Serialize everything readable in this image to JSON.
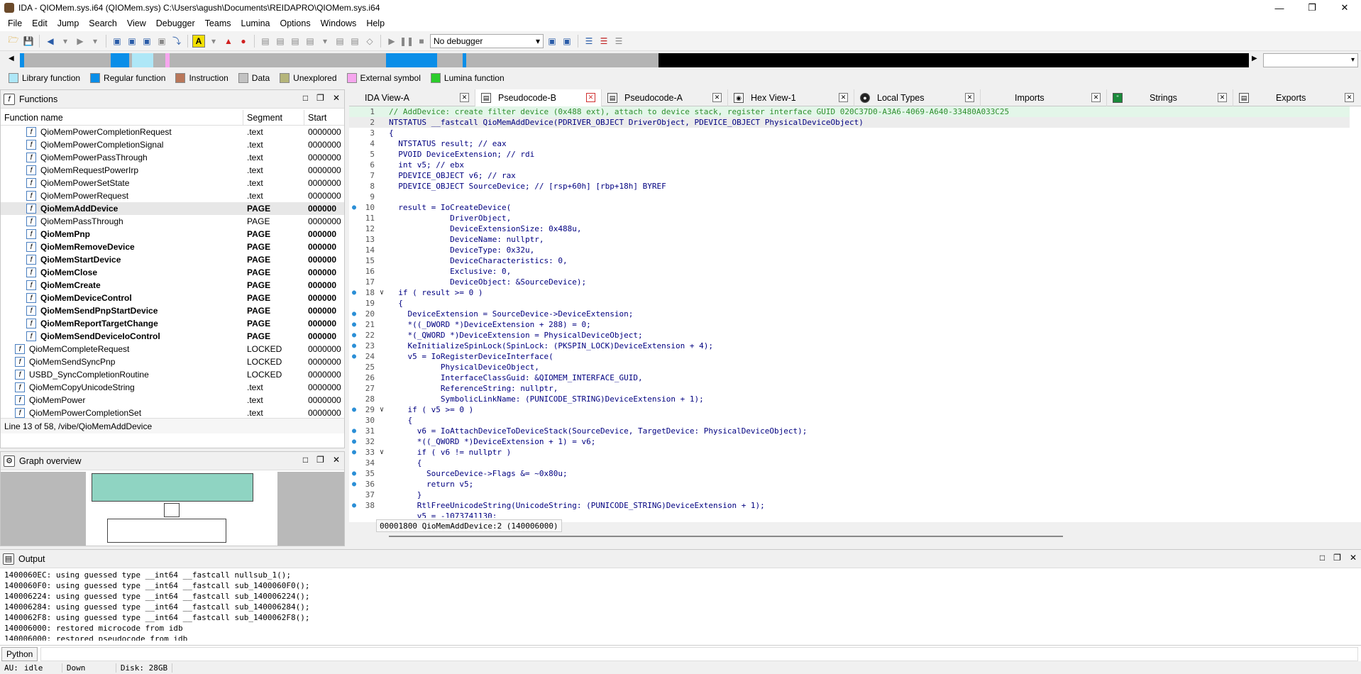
{
  "window": {
    "title": "IDA - QIOMem.sys.i64 (QIOMem.sys) C:\\Users\\agush\\Documents\\REIDAPRO\\QIOMem.sys.i64"
  },
  "menu": [
    "File",
    "Edit",
    "Jump",
    "Search",
    "View",
    "Debugger",
    "Teams",
    "Lumina",
    "Options",
    "Windows",
    "Help"
  ],
  "toolbar": {
    "debugger_select": "No debugger"
  },
  "legend": [
    {
      "label": "Library function",
      "color": "#aee7f7"
    },
    {
      "label": "Regular function",
      "color": "#0a8ee8"
    },
    {
      "label": "Instruction",
      "color": "#b9775a"
    },
    {
      "label": "Data",
      "color": "#c2c2c2"
    },
    {
      "label": "Unexplored",
      "color": "#b5b57a"
    },
    {
      "label": "External symbol",
      "color": "#f6a6ee"
    },
    {
      "label": "Lumina function",
      "color": "#2ccc2c"
    }
  ],
  "functions": {
    "title": "Functions",
    "columns": [
      "Function name",
      "Segment",
      "Start"
    ],
    "rows": [
      {
        "name": "QioMemPowerCompletionRequest",
        "segment": ".text",
        "start": "0000000",
        "bold": false,
        "indent": true
      },
      {
        "name": "QioMemPowerCompletionSignal",
        "segment": ".text",
        "start": "0000000",
        "bold": false,
        "indent": true
      },
      {
        "name": "QioMemPowerPassThrough",
        "segment": ".text",
        "start": "0000000",
        "bold": false,
        "indent": true
      },
      {
        "name": "QioMemRequestPowerIrp",
        "segment": ".text",
        "start": "0000000",
        "bold": false,
        "indent": true
      },
      {
        "name": "QioMemPowerSetState",
        "segment": ".text",
        "start": "0000000",
        "bold": false,
        "indent": true
      },
      {
        "name": "QioMemPowerRequest",
        "segment": ".text",
        "start": "0000000",
        "bold": false,
        "indent": true
      },
      {
        "name": "QioMemAddDevice",
        "segment": "PAGE",
        "start": "000000",
        "bold": true,
        "indent": true,
        "selected": true
      },
      {
        "name": "QioMemPassThrough",
        "segment": "PAGE",
        "start": "0000000",
        "bold": false,
        "indent": true
      },
      {
        "name": "QioMemPnp",
        "segment": "PAGE",
        "start": "000000",
        "bold": true,
        "indent": true
      },
      {
        "name": "QioMemRemoveDevice",
        "segment": "PAGE",
        "start": "000000",
        "bold": true,
        "indent": true
      },
      {
        "name": "QioMemStartDevice",
        "segment": "PAGE",
        "start": "000000",
        "bold": true,
        "indent": true
      },
      {
        "name": "QioMemClose",
        "segment": "PAGE",
        "start": "000000",
        "bold": true,
        "indent": true
      },
      {
        "name": "QioMemCreate",
        "segment": "PAGE",
        "start": "000000",
        "bold": true,
        "indent": true
      },
      {
        "name": "QioMemDeviceControl",
        "segment": "PAGE",
        "start": "000000",
        "bold": true,
        "indent": true
      },
      {
        "name": "QioMemSendPnpStartDevice",
        "segment": "PAGE",
        "start": "000000",
        "bold": true,
        "indent": true
      },
      {
        "name": "QioMemReportTargetChange",
        "segment": "PAGE",
        "start": "000000",
        "bold": true,
        "indent": true
      },
      {
        "name": "QioMemSendDeviceIoControl",
        "segment": "PAGE",
        "start": "000000",
        "bold": true,
        "indent": true
      },
      {
        "name": "QioMemCompleteRequest",
        "segment": "LOCKED",
        "start": "0000000",
        "bold": false,
        "indent": false
      },
      {
        "name": "QioMemSendSyncPnp",
        "segment": "LOCKED",
        "start": "0000000",
        "bold": false,
        "indent": false
      },
      {
        "name": "USBD_SyncCompletionRoutine",
        "segment": "LOCKED",
        "start": "0000000",
        "bold": false,
        "indent": false
      },
      {
        "name": "QioMemCopyUnicodeString",
        "segment": ".text",
        "start": "0000000",
        "bold": false,
        "indent": false
      },
      {
        "name": "QioMemPower",
        "segment": ".text",
        "start": "0000000",
        "bold": false,
        "indent": false
      },
      {
        "name": "QioMemPowerCompletionSet",
        "segment": ".text",
        "start": "0000000",
        "bold": false,
        "indent": false
      }
    ],
    "status": "Line 13 of 58, /vibe/QioMemAddDevice"
  },
  "graph_overview": {
    "title": "Graph overview"
  },
  "tabs": [
    {
      "label": "IDA View-A",
      "active": false
    },
    {
      "label": "Pseudocode-B",
      "active": true
    },
    {
      "label": "Pseudocode-A",
      "active": false
    },
    {
      "label": "Hex View-1",
      "active": false
    },
    {
      "label": "Local Types",
      "active": false
    },
    {
      "label": "Imports",
      "active": false
    },
    {
      "label": "Strings",
      "active": false
    },
    {
      "label": "Exports",
      "active": false
    }
  ],
  "code": {
    "lines": [
      {
        "n": "1",
        "t": "// AddDevice: create filter device (0x488 ext), attach to device stack, register interface GUID 020C37D0-A3A6-4069-A640-33480A033C25",
        "dot": false,
        "fold": "",
        "cls": "cmt hl"
      },
      {
        "n": "2",
        "t": "NTSTATUS __fastcall QioMemAddDevice(PDRIVER_OBJECT DriverObject, PDEVICE_OBJECT PhysicalDeviceObject)",
        "dot": false,
        "fold": "",
        "cls": "cur"
      },
      {
        "n": "3",
        "t": "{",
        "dot": false,
        "fold": "",
        "cls": ""
      },
      {
        "n": "4",
        "t": "  NTSTATUS result; // eax",
        "dot": false,
        "fold": "",
        "cls": ""
      },
      {
        "n": "5",
        "t": "  PVOID DeviceExtension; // rdi",
        "dot": false,
        "fold": "",
        "cls": ""
      },
      {
        "n": "6",
        "t": "  int v5; // ebx",
        "dot": false,
        "fold": "",
        "cls": ""
      },
      {
        "n": "7",
        "t": "  PDEVICE_OBJECT v6; // rax",
        "dot": false,
        "fold": "",
        "cls": ""
      },
      {
        "n": "8",
        "t": "  PDEVICE_OBJECT SourceDevice; // [rsp+60h] [rbp+18h] BYREF",
        "dot": false,
        "fold": "",
        "cls": ""
      },
      {
        "n": "9",
        "t": "",
        "dot": false,
        "fold": "",
        "cls": ""
      },
      {
        "n": "10",
        "t": "  result = IoCreateDevice(",
        "dot": true,
        "fold": "",
        "cls": ""
      },
      {
        "n": "11",
        "t": "             DriverObject,",
        "dot": false,
        "fold": "",
        "cls": ""
      },
      {
        "n": "12",
        "t": "             DeviceExtensionSize: 0x488u,",
        "dot": false,
        "fold": "",
        "cls": ""
      },
      {
        "n": "13",
        "t": "             DeviceName: nullptr,",
        "dot": false,
        "fold": "",
        "cls": ""
      },
      {
        "n": "14",
        "t": "             DeviceType: 0x32u,",
        "dot": false,
        "fold": "",
        "cls": ""
      },
      {
        "n": "15",
        "t": "             DeviceCharacteristics: 0,",
        "dot": false,
        "fold": "",
        "cls": ""
      },
      {
        "n": "16",
        "t": "             Exclusive: 0,",
        "dot": false,
        "fold": "",
        "cls": ""
      },
      {
        "n": "17",
        "t": "             DeviceObject: &SourceDevice);",
        "dot": false,
        "fold": "",
        "cls": ""
      },
      {
        "n": "18",
        "t": "  if ( result >= 0 )",
        "dot": true,
        "fold": "v",
        "cls": ""
      },
      {
        "n": "19",
        "t": "  {",
        "dot": false,
        "fold": "",
        "cls": ""
      },
      {
        "n": "20",
        "t": "    DeviceExtension = SourceDevice->DeviceExtension;",
        "dot": true,
        "fold": "",
        "cls": ""
      },
      {
        "n": "21",
        "t": "    *((_DWORD *)DeviceExtension + 288) = 0;",
        "dot": true,
        "fold": "",
        "cls": ""
      },
      {
        "n": "22",
        "t": "    *(_QWORD *)DeviceExtension = PhysicalDeviceObject;",
        "dot": true,
        "fold": "",
        "cls": ""
      },
      {
        "n": "23",
        "t": "    KeInitializeSpinLock(SpinLock: (PKSPIN_LOCK)DeviceExtension + 4);",
        "dot": true,
        "fold": "",
        "cls": ""
      },
      {
        "n": "24",
        "t": "    v5 = IoRegisterDeviceInterface(",
        "dot": true,
        "fold": "",
        "cls": ""
      },
      {
        "n": "25",
        "t": "           PhysicalDeviceObject,",
        "dot": false,
        "fold": "",
        "cls": ""
      },
      {
        "n": "26",
        "t": "           InterfaceClassGuid: &QIOMEM_INTERFACE_GUID,",
        "dot": false,
        "fold": "",
        "cls": ""
      },
      {
        "n": "27",
        "t": "           ReferenceString: nullptr,",
        "dot": false,
        "fold": "",
        "cls": ""
      },
      {
        "n": "28",
        "t": "           SymbolicLinkName: (PUNICODE_STRING)DeviceExtension + 1);",
        "dot": false,
        "fold": "",
        "cls": ""
      },
      {
        "n": "29",
        "t": "    if ( v5 >= 0 )",
        "dot": true,
        "fold": "v",
        "cls": ""
      },
      {
        "n": "30",
        "t": "    {",
        "dot": false,
        "fold": "",
        "cls": ""
      },
      {
        "n": "31",
        "t": "      v6 = IoAttachDeviceToDeviceStack(SourceDevice, TargetDevice: PhysicalDeviceObject);",
        "dot": true,
        "fold": "",
        "cls": ""
      },
      {
        "n": "32",
        "t": "      *((_QWORD *)DeviceExtension + 1) = v6;",
        "dot": true,
        "fold": "",
        "cls": ""
      },
      {
        "n": "33",
        "t": "      if ( v6 != nullptr )",
        "dot": true,
        "fold": "v",
        "cls": ""
      },
      {
        "n": "34",
        "t": "      {",
        "dot": false,
        "fold": "",
        "cls": ""
      },
      {
        "n": "35",
        "t": "        SourceDevice->Flags &= ~0x80u;",
        "dot": true,
        "fold": "",
        "cls": ""
      },
      {
        "n": "36",
        "t": "        return v5;",
        "dot": true,
        "fold": "",
        "cls": ""
      },
      {
        "n": "37",
        "t": "      }",
        "dot": false,
        "fold": "",
        "cls": ""
      },
      {
        "n": "38",
        "t": "      RtlFreeUnicodeString(UnicodeString: (PUNICODE_STRING)DeviceExtension + 1);",
        "dot": true,
        "fold": "",
        "cls": ""
      },
      {
        "n": "",
        "t": "      v5 = -1073741130;",
        "dot": false,
        "fold": "",
        "cls": ""
      }
    ],
    "status": "00001800 QioMemAddDevice:2 (140006000)"
  },
  "output": {
    "title": "Output",
    "lines": [
      "1400060EC: using guessed type __int64 __fastcall nullsub_1();",
      "1400060F0: using guessed type __int64 __fastcall sub_1400060F0();",
      "140006224: using guessed type __int64 __fastcall sub_140006224();",
      "140006284: using guessed type __int64 __fastcall sub_140006284();",
      "1400062F8: using guessed type __int64 __fastcall sub_1400062F8();",
      "140006000: restored microcode from idb",
      "140006000: restored pseudocode from idb"
    ],
    "python_label": "Python"
  },
  "statusbar": {
    "au": "AU:",
    "state": "idle",
    "direction": "Down",
    "disk": "Disk: 28GB"
  }
}
